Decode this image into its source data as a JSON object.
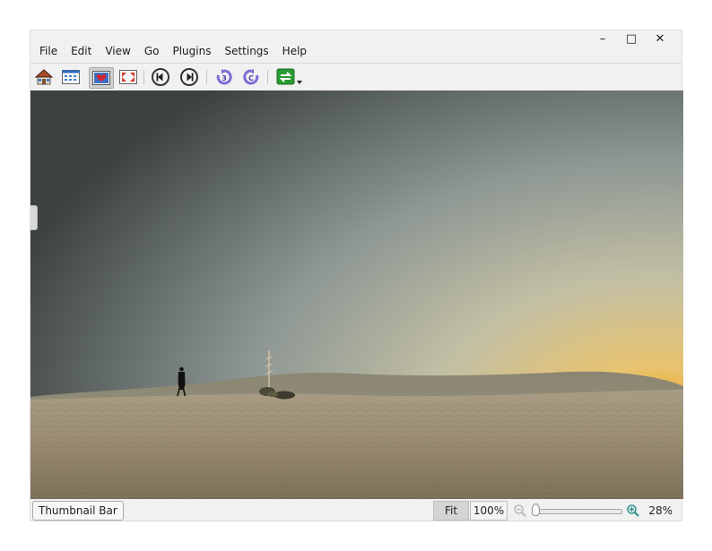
{
  "menu": [
    "File",
    "Edit",
    "View",
    "Go",
    "Plugins",
    "Settings",
    "Help"
  ],
  "window_controls": {
    "minimize": "–",
    "maximize": "□",
    "close": "✕"
  },
  "toolbar": {
    "icons": [
      "home-icon",
      "thumbnail-view-icon",
      "preview-icon",
      "fullscreen-icon",
      "previous-icon",
      "next-icon",
      "rotate-left-icon",
      "rotate-right-icon",
      "export-icon"
    ],
    "active": "preview-icon"
  },
  "status": {
    "thumbnail_bar": "Thumbnail Bar",
    "fit": "Fit",
    "hundred": "100%",
    "zoom": "28%"
  },
  "zoom_level": 0.28
}
